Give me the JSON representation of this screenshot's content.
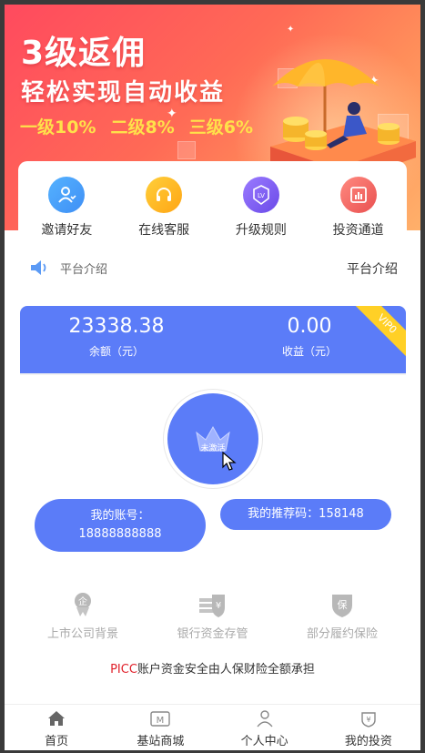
{
  "banner": {
    "title": "3级返佣",
    "subtitle": "轻松实现自动收益",
    "rates": [
      "一级10%",
      "二级8%",
      "三级6%"
    ]
  },
  "menu": [
    {
      "label": "邀请好友",
      "icon": "invite-user-icon",
      "color": "#3f8ff5"
    },
    {
      "label": "在线客服",
      "icon": "headset-icon",
      "color": "#ffb31a"
    },
    {
      "label": "升级规则",
      "icon": "level-badge-icon",
      "color": "#7a5df0"
    },
    {
      "label": "投资通道",
      "icon": "chart-icon",
      "color": "#f0605f"
    }
  ],
  "notice": {
    "text": "平台介绍",
    "link": "平台介绍"
  },
  "balance": {
    "amount": "23338.38",
    "amount_label": "余额（元）",
    "income": "0.00",
    "income_label": "收益（元）",
    "vip": "VIP0"
  },
  "level": {
    "crown_label": "未激活"
  },
  "account": {
    "label": "我的账号：",
    "value": "18888888888",
    "referral": "我的推荐码：158148"
  },
  "features": [
    {
      "label": "上市公司背景",
      "icon": "listed-company-icon"
    },
    {
      "label": "银行资金存管",
      "icon": "bank-deposit-icon"
    },
    {
      "label": "部分履约保险",
      "icon": "insurance-shield-icon"
    }
  ],
  "guarantee": {
    "brand": "PICC",
    "text": "账户资金安全由人保财险全额承担"
  },
  "tabs": [
    {
      "label": "首页",
      "icon": "home-icon"
    },
    {
      "label": "基站商城",
      "icon": "store-icon"
    },
    {
      "label": "个人中心",
      "icon": "user-icon"
    },
    {
      "label": "我的投资",
      "icon": "wallet-icon"
    }
  ],
  "colors": {
    "primary": "#5b7cf8",
    "banner_start": "#ff4a5e",
    "banner_end": "#ffb06a",
    "rate_yellow": "#ffe14a",
    "vip_gold": "#ffd026",
    "picc_red": "#e0202a"
  }
}
